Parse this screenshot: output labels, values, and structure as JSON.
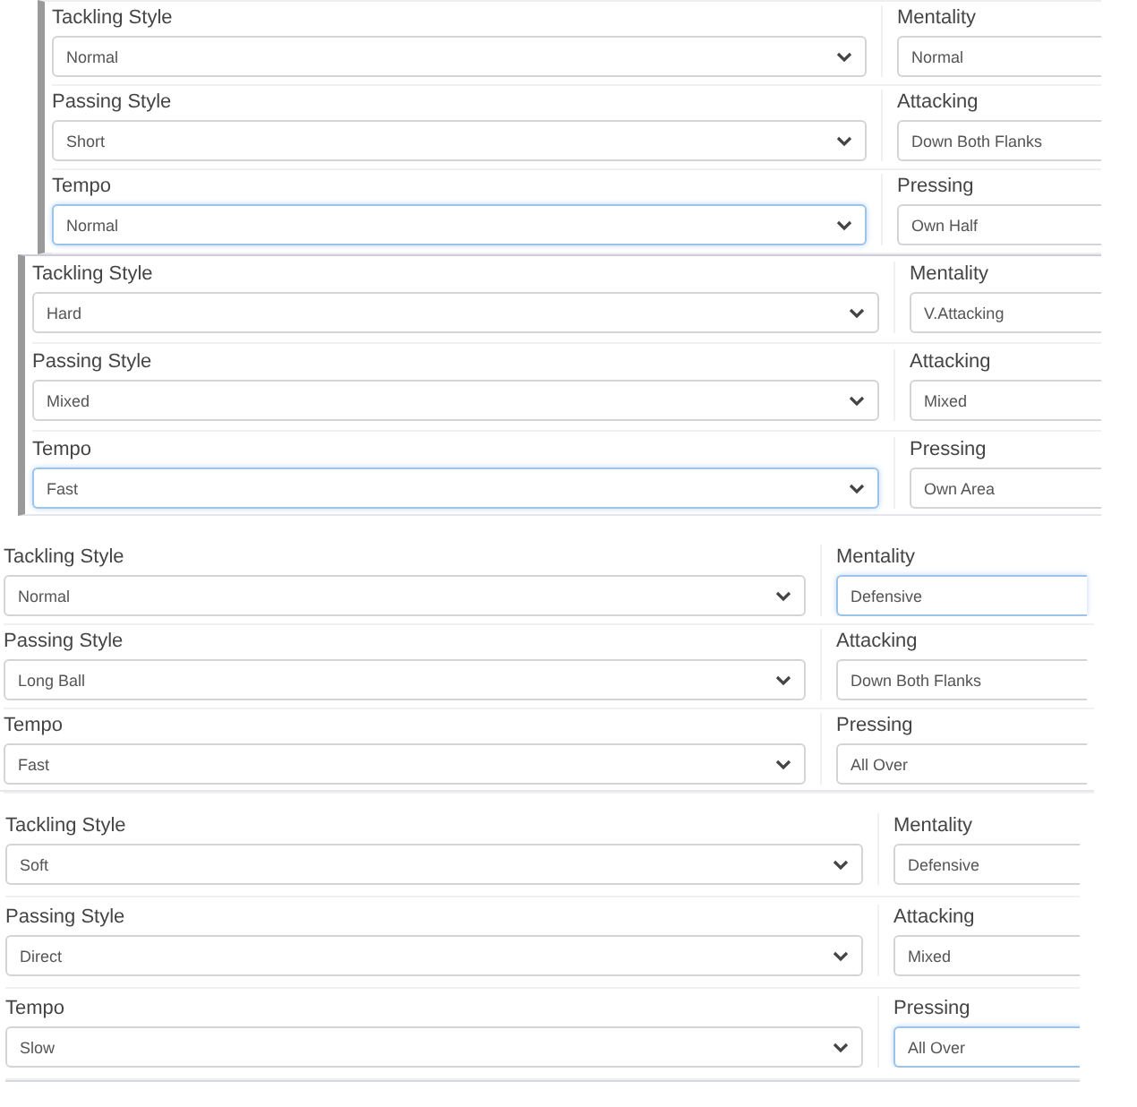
{
  "panels": [
    {
      "side_bar": true,
      "rows": [
        {
          "left": {
            "label": "Tackling Style",
            "value": "Normal",
            "focused": false
          },
          "right": {
            "label": "Mentality",
            "value": "Normal",
            "focused": false
          }
        },
        {
          "left": {
            "label": "Passing Style",
            "value": "Short",
            "focused": false
          },
          "right": {
            "label": "Attacking",
            "value": "Down Both Flanks",
            "focused": false
          }
        },
        {
          "left": {
            "label": "Tempo",
            "value": "Normal",
            "focused": true
          },
          "right": {
            "label": "Pressing",
            "value": "Own Half",
            "focused": false
          }
        }
      ]
    },
    {
      "side_bar": true,
      "rows": [
        {
          "left": {
            "label": "Tackling Style",
            "value": "Hard",
            "focused": false
          },
          "right": {
            "label": "Mentality",
            "value": "V.Attacking",
            "focused": false
          }
        },
        {
          "left": {
            "label": "Passing Style",
            "value": "Mixed",
            "focused": false
          },
          "right": {
            "label": "Attacking",
            "value": "Mixed",
            "focused": false
          }
        },
        {
          "left": {
            "label": "Tempo",
            "value": "Fast",
            "focused": true
          },
          "right": {
            "label": "Pressing",
            "value": "Own Area",
            "focused": false
          }
        }
      ]
    },
    {
      "side_bar": false,
      "rows": [
        {
          "left": {
            "label": "Tackling Style",
            "value": "Normal",
            "focused": false
          },
          "right": {
            "label": "Mentality",
            "value": "Defensive",
            "focused": true
          }
        },
        {
          "left": {
            "label": "Passing Style",
            "value": "Long Ball",
            "focused": false
          },
          "right": {
            "label": "Attacking",
            "value": "Down Both Flanks",
            "focused": false
          }
        },
        {
          "left": {
            "label": "Tempo",
            "value": "Fast",
            "focused": false
          },
          "right": {
            "label": "Pressing",
            "value": "All Over",
            "focused": false
          }
        }
      ]
    },
    {
      "side_bar": false,
      "rows": [
        {
          "left": {
            "label": "Tackling Style",
            "value": "Soft",
            "focused": false
          },
          "right": {
            "label": "Mentality",
            "value": "Defensive",
            "focused": false
          }
        },
        {
          "left": {
            "label": "Passing Style",
            "value": "Direct",
            "focused": false
          },
          "right": {
            "label": "Attacking",
            "value": "Mixed",
            "focused": false
          }
        },
        {
          "left": {
            "label": "Tempo",
            "value": "Slow",
            "focused": false
          },
          "right": {
            "label": "Pressing",
            "value": "All Over",
            "focused": true
          }
        }
      ]
    }
  ]
}
